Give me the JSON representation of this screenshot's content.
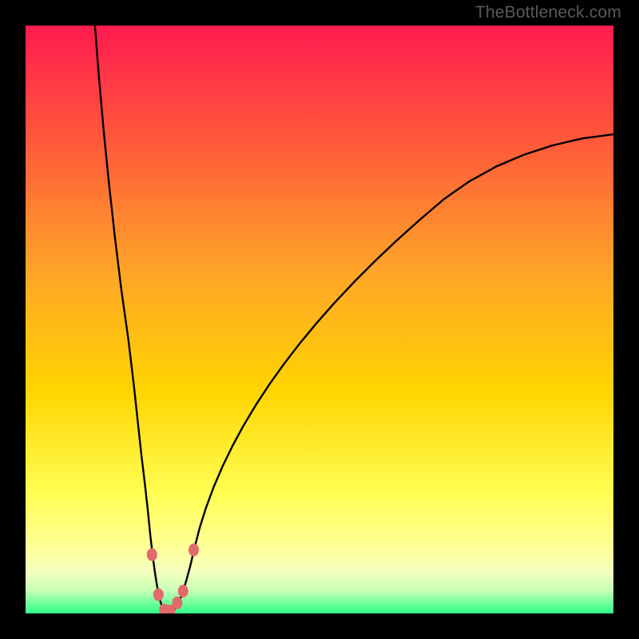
{
  "watermark": "TheBottleneck.com",
  "colors": {
    "gradient_top": "#ff1a4f",
    "gradient_mid1": "#ff7a2e",
    "gradient_mid2": "#ffd200",
    "gradient_mid3": "#ffff66",
    "gradient_bottom_pale": "#f2ffc2",
    "gradient_bottom": "#2fff89",
    "curve": "#000000",
    "marker_fill": "#e26a6a",
    "marker_stroke": "#c94f4f",
    "frame": "#000000"
  },
  "chart_data": {
    "type": "line",
    "title": "",
    "xlabel": "",
    "ylabel": "",
    "xlim": [
      0,
      100
    ],
    "ylim": [
      0,
      100
    ],
    "grid": false,
    "legend": false,
    "x": [
      11.8,
      12.5,
      13.3,
      14.2,
      15.2,
      16.3,
      17.5,
      18.4,
      19.1,
      19.7,
      20.3,
      20.8,
      21.2,
      21.6,
      22.0,
      22.4,
      22.8,
      23.2,
      23.6,
      24.0,
      24.5,
      25.0,
      25.6,
      26.2,
      26.8,
      27.4,
      28.0,
      28.7,
      29.6,
      30.7,
      32.0,
      33.5,
      35.2,
      37.1,
      39.2,
      41.5,
      44.0,
      46.7,
      49.6,
      52.7,
      56.0,
      59.5,
      63.2,
      67.1,
      71.2,
      75.5,
      80.0,
      84.7,
      89.6,
      94.7,
      100.0
    ],
    "y": [
      100.0,
      91.0,
      82.0,
      73.0,
      64.0,
      55.0,
      46.5,
      39.0,
      32.5,
      27.0,
      22.0,
      17.5,
      13.5,
      10.0,
      7.0,
      4.5,
      2.5,
      1.2,
      0.5,
      0.2,
      0.2,
      0.4,
      1.0,
      2.2,
      3.8,
      5.8,
      8.0,
      11.0,
      14.5,
      18.0,
      21.5,
      25.0,
      28.5,
      32.0,
      35.5,
      39.0,
      42.5,
      46.0,
      49.5,
      53.0,
      56.5,
      60.0,
      63.5,
      67.0,
      70.5,
      73.5,
      76.0,
      78.0,
      79.6,
      80.8,
      81.5
    ],
    "markers": [
      {
        "x": 21.5,
        "y": 10.0
      },
      {
        "x": 22.6,
        "y": 3.2
      },
      {
        "x": 23.6,
        "y": 0.6
      },
      {
        "x": 24.6,
        "y": 0.4
      },
      {
        "x": 25.8,
        "y": 1.8
      },
      {
        "x": 26.8,
        "y": 3.8
      },
      {
        "x": 28.6,
        "y": 10.8
      }
    ],
    "notes": "Axes are unlabeled in the image; x/y are normalized 0-100 across the plot area. Curve values estimated from pixel positions."
  }
}
